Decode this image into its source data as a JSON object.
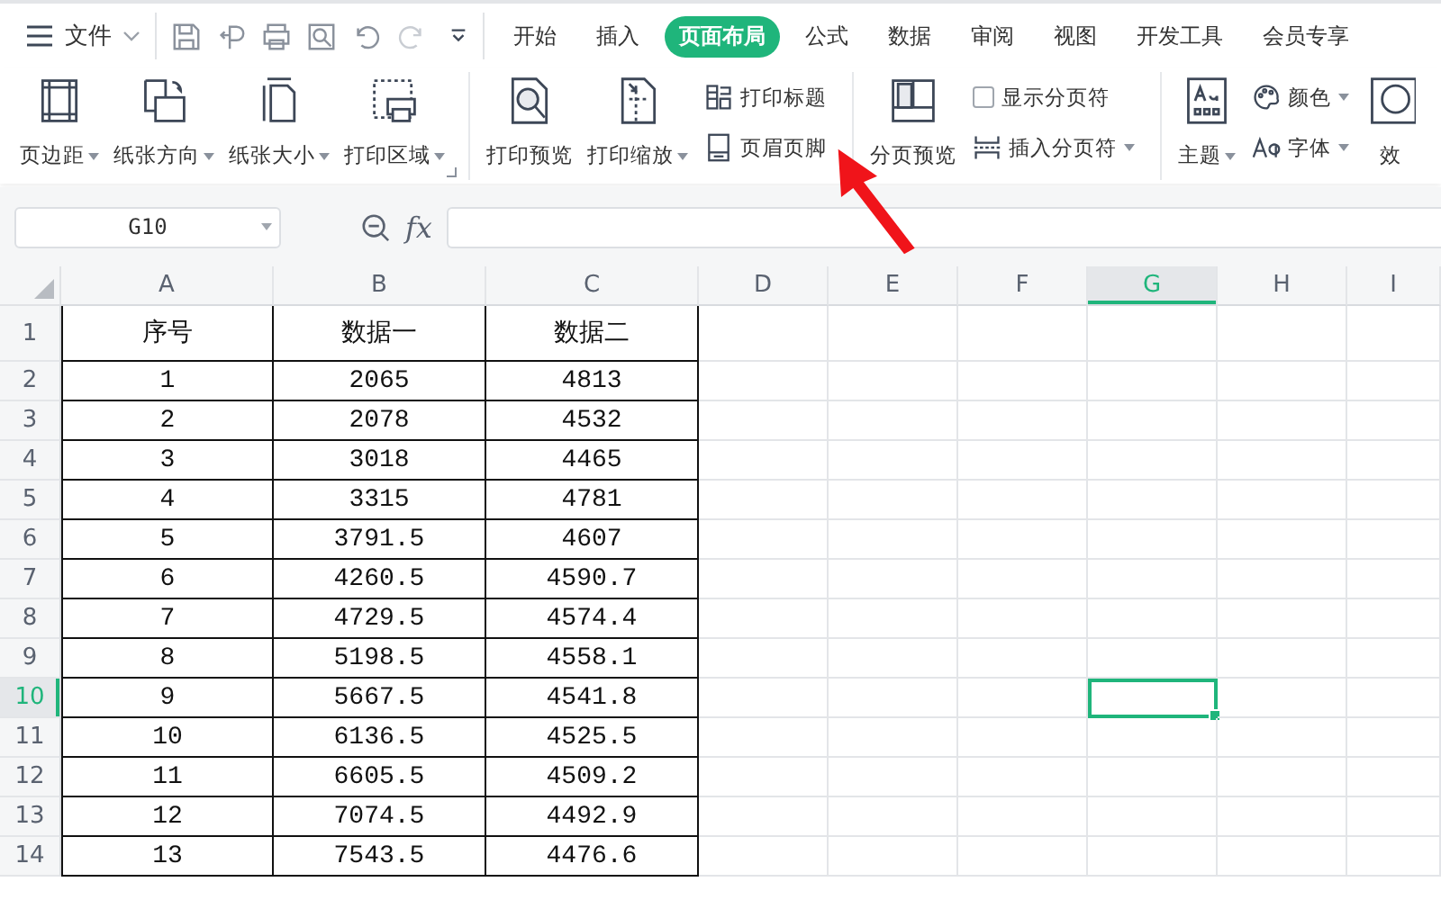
{
  "menu": {
    "file_label": "文件"
  },
  "tabs": [
    {
      "label": "开始",
      "selected": false
    },
    {
      "label": "插入",
      "selected": false
    },
    {
      "label": "页面布局",
      "selected": true
    },
    {
      "label": "公式",
      "selected": false
    },
    {
      "label": "数据",
      "selected": false
    },
    {
      "label": "审阅",
      "selected": false
    },
    {
      "label": "视图",
      "selected": false
    },
    {
      "label": "开发工具",
      "selected": false
    },
    {
      "label": "会员专享",
      "selected": false
    }
  ],
  "ribbon": {
    "groups": [
      {
        "launcher": true,
        "items": [
          {
            "kind": "large",
            "label": "页边距",
            "dropdown": true
          },
          {
            "kind": "large",
            "label": "纸张方向",
            "dropdown": true
          },
          {
            "kind": "large",
            "label": "纸张大小",
            "dropdown": true
          },
          {
            "kind": "large",
            "label": "打印区域",
            "dropdown": true
          }
        ]
      },
      {
        "launcher": false,
        "items": [
          {
            "kind": "large",
            "label": "打印预览",
            "dropdown": false
          },
          {
            "kind": "large",
            "label": "打印缩放",
            "dropdown": true
          },
          {
            "kind": "stack",
            "entries": [
              {
                "kind": "small",
                "label": "打印标题",
                "dropdown": false
              },
              {
                "kind": "small",
                "label": "页眉页脚",
                "dropdown": false
              }
            ]
          }
        ]
      },
      {
        "launcher": false,
        "items": [
          {
            "kind": "large",
            "label": "分页预览",
            "dropdown": false
          },
          {
            "kind": "stack",
            "entries": [
              {
                "kind": "checkbox",
                "label": "显示分页符",
                "checked": false
              },
              {
                "kind": "small",
                "label": "插入分页符",
                "dropdown": true
              }
            ]
          }
        ]
      },
      {
        "launcher": false,
        "items": [
          {
            "kind": "large",
            "label": "主题",
            "dropdown": true
          },
          {
            "kind": "stack",
            "entries": [
              {
                "kind": "small",
                "label": "颜色",
                "dropdown": true
              },
              {
                "kind": "small",
                "label": "字体",
                "dropdown": true
              }
            ]
          },
          {
            "kind": "large",
            "label": "效",
            "dropdown": false
          }
        ]
      }
    ]
  },
  "formula_bar": {
    "name_box": "G10",
    "fx": "fx"
  },
  "columns": [
    {
      "label": "A",
      "selected": false
    },
    {
      "label": "B",
      "selected": false
    },
    {
      "label": "C",
      "selected": false
    },
    {
      "label": "D",
      "selected": false
    },
    {
      "label": "E",
      "selected": false
    },
    {
      "label": "F",
      "selected": false
    },
    {
      "label": "G",
      "selected": true
    },
    {
      "label": "H",
      "selected": false
    },
    {
      "label": "I",
      "selected": false
    }
  ],
  "rows": [
    {
      "number": "1",
      "selected": false,
      "cells": [
        "序号",
        "数据一",
        "数据二"
      ]
    },
    {
      "number": "2",
      "selected": false,
      "cells": [
        "1",
        "2065",
        "4813"
      ]
    },
    {
      "number": "3",
      "selected": false,
      "cells": [
        "2",
        "2078",
        "4532"
      ]
    },
    {
      "number": "4",
      "selected": false,
      "cells": [
        "3",
        "3018",
        "4465"
      ]
    },
    {
      "number": "5",
      "selected": false,
      "cells": [
        "4",
        "3315",
        "4781"
      ]
    },
    {
      "number": "6",
      "selected": false,
      "cells": [
        "5",
        "3791.5",
        "4607"
      ]
    },
    {
      "number": "7",
      "selected": false,
      "cells": [
        "6",
        "4260.5",
        "4590.7"
      ]
    },
    {
      "number": "8",
      "selected": false,
      "cells": [
        "7",
        "4729.5",
        "4574.4"
      ]
    },
    {
      "number": "9",
      "selected": false,
      "cells": [
        "8",
        "5198.5",
        "4558.1"
      ]
    },
    {
      "number": "10",
      "selected": true,
      "cells": [
        "9",
        "5667.5",
        "4541.8"
      ]
    },
    {
      "number": "11",
      "selected": false,
      "cells": [
        "10",
        "6136.5",
        "4525.5"
      ]
    },
    {
      "number": "12",
      "selected": false,
      "cells": [
        "11",
        "6605.5",
        "4509.2"
      ]
    },
    {
      "number": "13",
      "selected": false,
      "cells": [
        "12",
        "7074.5",
        "4492.9"
      ]
    },
    {
      "number": "14",
      "selected": false,
      "cells": [
        "13",
        "7543.5",
        "4476.6"
      ]
    }
  ]
}
